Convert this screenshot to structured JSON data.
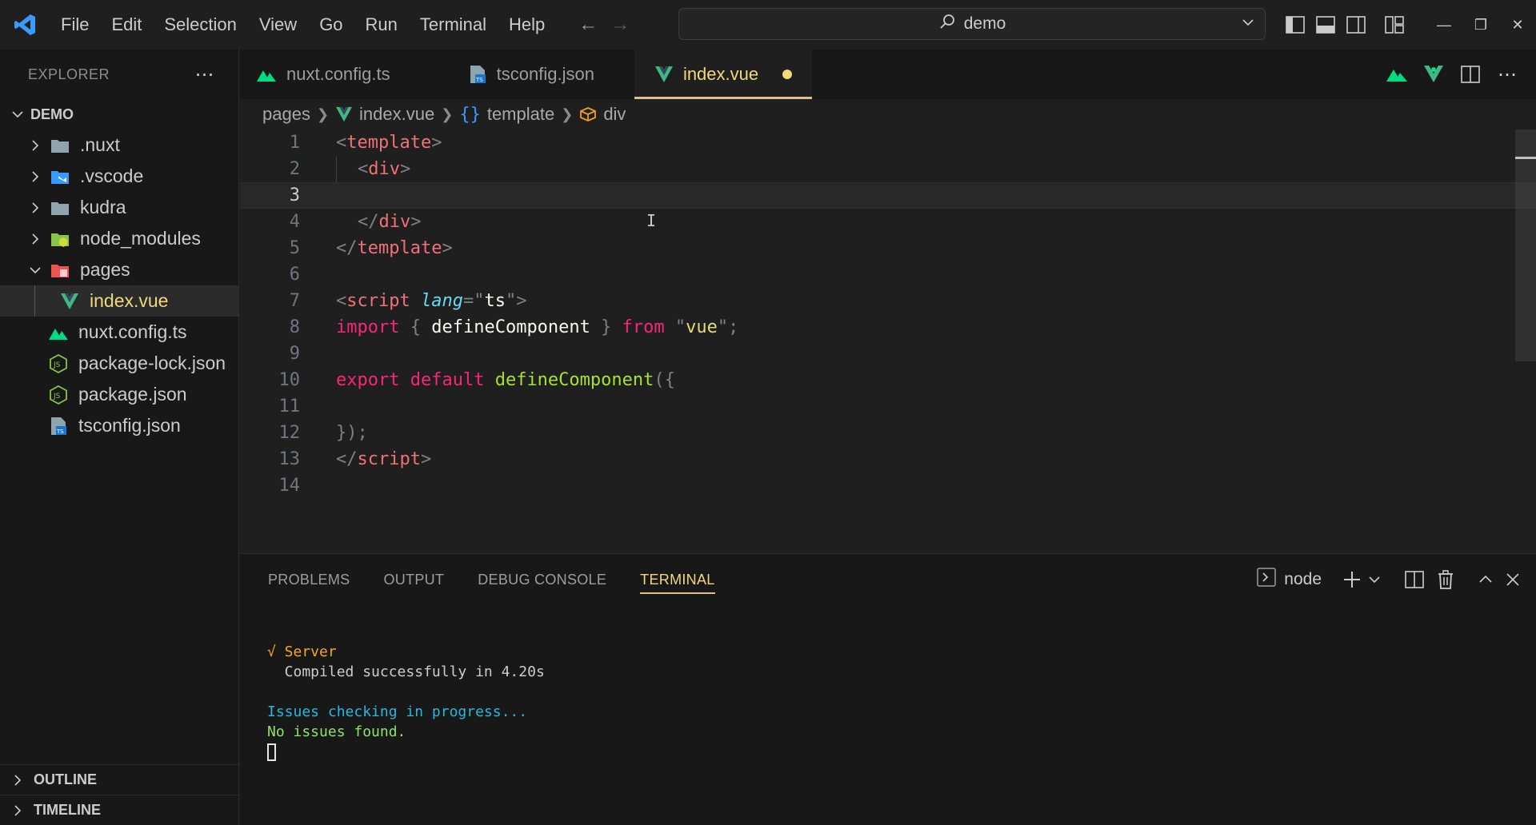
{
  "titlebar": {
    "menu": [
      "File",
      "Edit",
      "Selection",
      "View",
      "Go",
      "Run",
      "Terminal",
      "Help"
    ],
    "search_text": "demo"
  },
  "sidebar": {
    "title": "EXPLORER",
    "root": "DEMO",
    "items": [
      {
        "label": ".nuxt",
        "icon": "folder-icon",
        "type": "folder"
      },
      {
        "label": ".vscode",
        "icon": "vscode-folder-icon",
        "type": "folder"
      },
      {
        "label": "kudra",
        "icon": "folder-icon",
        "type": "folder"
      },
      {
        "label": "node_modules",
        "icon": "node-folder-icon",
        "type": "folder"
      },
      {
        "label": "pages",
        "icon": "pages-folder-icon",
        "type": "folder-open"
      },
      {
        "label": "index.vue",
        "icon": "vue-file-icon",
        "type": "file"
      },
      {
        "label": "nuxt.config.ts",
        "icon": "nuxt-file-icon",
        "type": "file"
      },
      {
        "label": "package-lock.json",
        "icon": "nodejs-file-icon",
        "type": "file"
      },
      {
        "label": "package.json",
        "icon": "nodejs-file-icon",
        "type": "file"
      },
      {
        "label": "tsconfig.json",
        "icon": "tsconfig-file-icon",
        "type": "file"
      }
    ],
    "outline": "OUTLINE",
    "timeline": "TIMELINE"
  },
  "tabs": [
    {
      "label": "nuxt.config.ts",
      "icon": "nuxt-file-icon",
      "active": false
    },
    {
      "label": "tsconfig.json",
      "icon": "tsconfig-file-icon",
      "active": false
    },
    {
      "label": "index.vue",
      "icon": "vue-file-icon",
      "active": true,
      "dirty": true
    }
  ],
  "breadcrumb": [
    "pages",
    "index.vue",
    "template",
    "div"
  ],
  "editor": {
    "line_numbers": [
      "1",
      "2",
      "3",
      "4",
      "5",
      "6",
      "7",
      "8",
      "9",
      "10",
      "11",
      "12",
      "13",
      "14"
    ],
    "current_line": 3,
    "lines": {
      "l1_open": "<",
      "l1_tag": "template",
      "l1_close": ">",
      "l2_open": "<",
      "l2_tag": "div",
      "l2_close": ">",
      "l4_open": "</",
      "l4_tag": "div",
      "l4_close": ">",
      "l5_open": "</",
      "l5_tag": "template",
      "l5_close": ">",
      "l7_open": "<",
      "l7_tag": "script",
      "l7_attr": "lang",
      "l7_eq": "=\"",
      "l7_val": "ts",
      "l7_q": "\"",
      "l7_close": ">",
      "l8_import": "import",
      "l8_lb": " { ",
      "l8_name": "defineComponent",
      "l8_rb": " } ",
      "l8_from": "from",
      "l8_q1": " \"",
      "l8_mod": "vue",
      "l8_q2": "\";",
      "l10_export": "export",
      "l10_default": "default",
      "l10_fn": "defineComponent",
      "l10_rest": "({",
      "l12": "});",
      "l13_open": "</",
      "l13_tag": "script",
      "l13_close": ">"
    }
  },
  "panel": {
    "tabs": [
      "PROBLEMS",
      "OUTPUT",
      "DEBUG CONSOLE",
      "TERMINAL"
    ],
    "active_tab": "TERMINAL",
    "terminal_name": "node",
    "output": {
      "line1": "√ Server",
      "line2": "  Compiled successfully in 4.20s",
      "line3": "Issues checking in progress...",
      "line4": "No issues found."
    }
  },
  "colors": {
    "accent": "#e2c08d",
    "active_text": "#f0d97a",
    "vscode_blue": "#3b99fc",
    "vue_green": "#41b883",
    "nuxt_green": "#00dc82"
  }
}
